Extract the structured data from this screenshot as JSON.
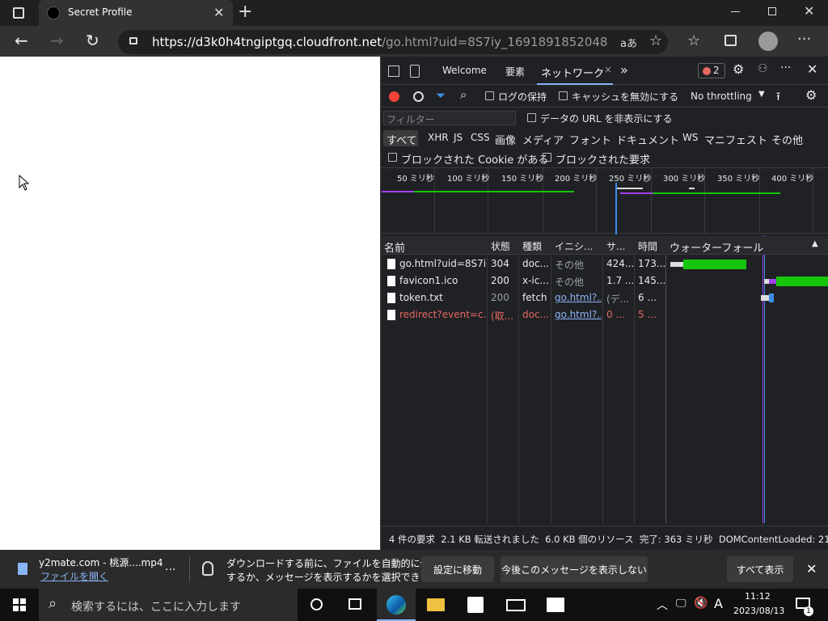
{
  "tab": {
    "title": "Secret Profile"
  },
  "address": {
    "url_host": "https://d3k0h4tngiptgq.cloudfront.net",
    "url_path": "/go.html?uid=8S7iy_1691891852048",
    "translate_label": "aあ"
  },
  "devtools": {
    "tabs": [
      "Welcome",
      "要素",
      "ネットワーク"
    ],
    "more_tabs": "»",
    "error_count": "2",
    "toolbar": {
      "preserve_log": "ログの保持",
      "disable_cache": "キャッシュを無効にする",
      "throttling": "No throttling"
    },
    "filter": {
      "placeholder": "フィルター",
      "hide_data_urls": "データの URL を非表示にする"
    },
    "types": [
      "すべて",
      "XHR",
      "JS",
      "CSS",
      "画像",
      "メディア",
      "フォント",
      "ドキュメント",
      "WS",
      "マニフェスト",
      "その他"
    ],
    "blocked_cookies": "ブロックされた Cookie がある",
    "blocked_requests": "ブロックされた要求",
    "timeline_ticks": [
      "50 ミリ秒",
      "100 ミリ秒",
      "150 ミリ秒",
      "200 ミリ秒",
      "250 ミリ秒",
      "300 ミリ秒",
      "350 ミリ秒",
      "400 ミリ秒"
    ],
    "columns": {
      "name": "名前",
      "status": "状態",
      "type": "種類",
      "initiator": "イニシ...",
      "size": "サ...",
      "time": "時間",
      "waterfall": "ウォーターフォール"
    },
    "requests": [
      {
        "name": "go.html?uid=8S7i...",
        "status": "304",
        "type": "doc...",
        "initiator": "その他",
        "size": "424...",
        "time": "173..."
      },
      {
        "name": "favicon1.ico",
        "status": "200",
        "type": "x-ic...",
        "initiator": "その他",
        "size": "1.7 ...",
        "time": "145..."
      },
      {
        "name": "token.txt",
        "status": "200",
        "type": "fetch",
        "initiator": "go.html?...",
        "size": "(デ...",
        "time": "6 ..."
      },
      {
        "name": "redirect?event=c...",
        "status": "(取...",
        "type": "doc...",
        "initiator": "go.html?...",
        "size": "0 ...",
        "time": "5 ..."
      }
    ],
    "summary": "4 件の要求  2.1 KB 転送されました  6.0 KB 個のリソース  完了: 363 ミリ秒  DOMContentLoaded: 213"
  },
  "download": {
    "filename": "y2mate.com - 桃源....mp4",
    "open_link": "ファイルを開く",
    "more": "...",
    "message_line1": "ダウンロードする前に、ファイルを自動的に保存",
    "message_line2": "するか、メッセージを表示するかを選択できます。",
    "settings_button": "設定に移動",
    "dont_show_button": "今後このメッセージを表示しない",
    "show_all_button": "すべて表示"
  },
  "taskbar": {
    "search_placeholder": "検索するには、ここに入力します",
    "ime": "A",
    "time": "11:12",
    "date": "2023/08/13",
    "notifications": "1"
  },
  "colors": {
    "accent_green": "#16c60c",
    "error_red": "#e46962",
    "link_blue": "#8ab4f8",
    "record_red": "#f44336"
  }
}
